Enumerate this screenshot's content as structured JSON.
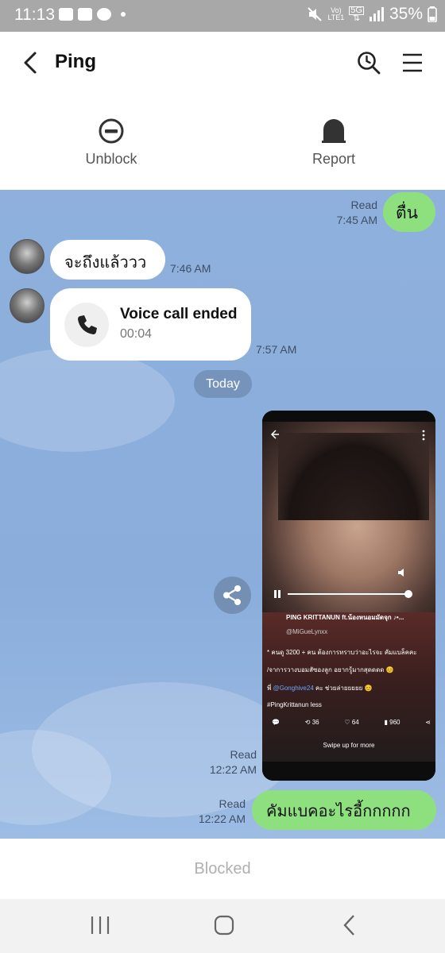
{
  "status_bar": {
    "time": "11:13",
    "net_top": "Vo)",
    "net_bottom": "LTE1",
    "five_g": "5G",
    "battery": "35%"
  },
  "header": {
    "title": "Ping"
  },
  "actions": {
    "unblock_label": "Unblock",
    "report_label": "Report"
  },
  "messages": {
    "m1": {
      "text": "ตื่น",
      "read": "Read",
      "time": "7:45 AM"
    },
    "m2": {
      "text": "จะถึงแล้ววว",
      "time": "7:46 AM"
    },
    "m3": {
      "title": "Voice call ended",
      "duration": "00:04",
      "time": "7:57 AM"
    },
    "today": "Today",
    "m4": {
      "read": "Read",
      "time": "12:22 AM"
    },
    "m5": {
      "text": "คัมแบคอะไรอี้กกกกก",
      "read": "Read",
      "time": "12:22 AM"
    }
  },
  "screenshot": {
    "song": "PING KRITTANUN ft.น้องหนอมมัดจุก ♪•...",
    "handle": "@MiGueLynxx",
    "caption1": "* คนดู 3200 + คน ต้องการทราบว่าอะไรจะ คัมแบล็คคะ",
    "caption2": "/จาการวางบอมสัซองลูก อยากรู้มากสุดดดด 😊",
    "caption3_pre": "พี่",
    "caption3_link": "@Gonghive24",
    "caption3_post": "คะ ช่วยล่ายยยยย 😊",
    "tag": "#PingKrittanun less",
    "stat_likes": "64",
    "stat_reposts": "36",
    "stat_views": "960",
    "swipe": "Swipe up for more"
  },
  "footer": {
    "blocked": "Blocked"
  }
}
